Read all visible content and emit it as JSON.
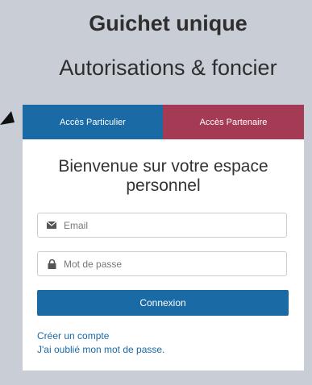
{
  "header": {
    "title": "Guichet unique",
    "subtitle": "Autorisations & foncier"
  },
  "tabs": [
    {
      "label": "Accès Particulier",
      "active": true,
      "color": "#1a6aa6"
    },
    {
      "label": "Accès Partenaire",
      "active": false,
      "color": "#a53a55"
    }
  ],
  "login": {
    "welcome": "Bienvenue sur votre espace personnel",
    "email_placeholder": "Email",
    "email_icon": "envelope-icon",
    "password_placeholder": "Mot de passe",
    "password_icon": "lock-icon",
    "submit_label": "Connexion",
    "create_account": "Créer un compte",
    "forgot_password": "J'ai oublié mon mot de passe."
  },
  "colors": {
    "background": "#c9cdd6",
    "primary": "#1a6aa6",
    "partner": "#a53a55"
  }
}
